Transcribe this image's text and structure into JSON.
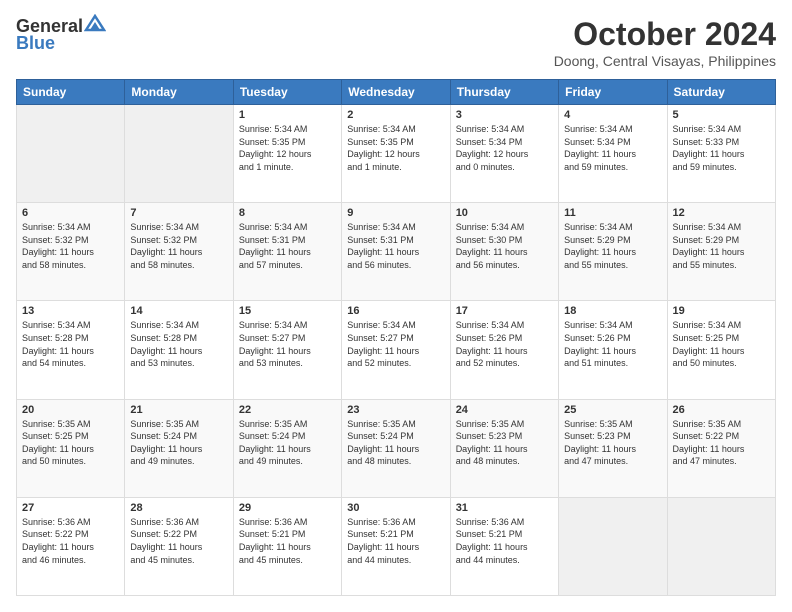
{
  "header": {
    "logo_line1": "General",
    "logo_line2": "Blue",
    "month_title": "October 2024",
    "subtitle": "Doong, Central Visayas, Philippines"
  },
  "days_of_week": [
    "Sunday",
    "Monday",
    "Tuesday",
    "Wednesday",
    "Thursday",
    "Friday",
    "Saturday"
  ],
  "weeks": [
    [
      {
        "day": "",
        "info": ""
      },
      {
        "day": "",
        "info": ""
      },
      {
        "day": "1",
        "info": "Sunrise: 5:34 AM\nSunset: 5:35 PM\nDaylight: 12 hours\nand 1 minute."
      },
      {
        "day": "2",
        "info": "Sunrise: 5:34 AM\nSunset: 5:35 PM\nDaylight: 12 hours\nand 1 minute."
      },
      {
        "day": "3",
        "info": "Sunrise: 5:34 AM\nSunset: 5:34 PM\nDaylight: 12 hours\nand 0 minutes."
      },
      {
        "day": "4",
        "info": "Sunrise: 5:34 AM\nSunset: 5:34 PM\nDaylight: 11 hours\nand 59 minutes."
      },
      {
        "day": "5",
        "info": "Sunrise: 5:34 AM\nSunset: 5:33 PM\nDaylight: 11 hours\nand 59 minutes."
      }
    ],
    [
      {
        "day": "6",
        "info": "Sunrise: 5:34 AM\nSunset: 5:32 PM\nDaylight: 11 hours\nand 58 minutes."
      },
      {
        "day": "7",
        "info": "Sunrise: 5:34 AM\nSunset: 5:32 PM\nDaylight: 11 hours\nand 58 minutes."
      },
      {
        "day": "8",
        "info": "Sunrise: 5:34 AM\nSunset: 5:31 PM\nDaylight: 11 hours\nand 57 minutes."
      },
      {
        "day": "9",
        "info": "Sunrise: 5:34 AM\nSunset: 5:31 PM\nDaylight: 11 hours\nand 56 minutes."
      },
      {
        "day": "10",
        "info": "Sunrise: 5:34 AM\nSunset: 5:30 PM\nDaylight: 11 hours\nand 56 minutes."
      },
      {
        "day": "11",
        "info": "Sunrise: 5:34 AM\nSunset: 5:29 PM\nDaylight: 11 hours\nand 55 minutes."
      },
      {
        "day": "12",
        "info": "Sunrise: 5:34 AM\nSunset: 5:29 PM\nDaylight: 11 hours\nand 55 minutes."
      }
    ],
    [
      {
        "day": "13",
        "info": "Sunrise: 5:34 AM\nSunset: 5:28 PM\nDaylight: 11 hours\nand 54 minutes."
      },
      {
        "day": "14",
        "info": "Sunrise: 5:34 AM\nSunset: 5:28 PM\nDaylight: 11 hours\nand 53 minutes."
      },
      {
        "day": "15",
        "info": "Sunrise: 5:34 AM\nSunset: 5:27 PM\nDaylight: 11 hours\nand 53 minutes."
      },
      {
        "day": "16",
        "info": "Sunrise: 5:34 AM\nSunset: 5:27 PM\nDaylight: 11 hours\nand 52 minutes."
      },
      {
        "day": "17",
        "info": "Sunrise: 5:34 AM\nSunset: 5:26 PM\nDaylight: 11 hours\nand 52 minutes."
      },
      {
        "day": "18",
        "info": "Sunrise: 5:34 AM\nSunset: 5:26 PM\nDaylight: 11 hours\nand 51 minutes."
      },
      {
        "day": "19",
        "info": "Sunrise: 5:34 AM\nSunset: 5:25 PM\nDaylight: 11 hours\nand 50 minutes."
      }
    ],
    [
      {
        "day": "20",
        "info": "Sunrise: 5:35 AM\nSunset: 5:25 PM\nDaylight: 11 hours\nand 50 minutes."
      },
      {
        "day": "21",
        "info": "Sunrise: 5:35 AM\nSunset: 5:24 PM\nDaylight: 11 hours\nand 49 minutes."
      },
      {
        "day": "22",
        "info": "Sunrise: 5:35 AM\nSunset: 5:24 PM\nDaylight: 11 hours\nand 49 minutes."
      },
      {
        "day": "23",
        "info": "Sunrise: 5:35 AM\nSunset: 5:24 PM\nDaylight: 11 hours\nand 48 minutes."
      },
      {
        "day": "24",
        "info": "Sunrise: 5:35 AM\nSunset: 5:23 PM\nDaylight: 11 hours\nand 48 minutes."
      },
      {
        "day": "25",
        "info": "Sunrise: 5:35 AM\nSunset: 5:23 PM\nDaylight: 11 hours\nand 47 minutes."
      },
      {
        "day": "26",
        "info": "Sunrise: 5:35 AM\nSunset: 5:22 PM\nDaylight: 11 hours\nand 47 minutes."
      }
    ],
    [
      {
        "day": "27",
        "info": "Sunrise: 5:36 AM\nSunset: 5:22 PM\nDaylight: 11 hours\nand 46 minutes."
      },
      {
        "day": "28",
        "info": "Sunrise: 5:36 AM\nSunset: 5:22 PM\nDaylight: 11 hours\nand 45 minutes."
      },
      {
        "day": "29",
        "info": "Sunrise: 5:36 AM\nSunset: 5:21 PM\nDaylight: 11 hours\nand 45 minutes."
      },
      {
        "day": "30",
        "info": "Sunrise: 5:36 AM\nSunset: 5:21 PM\nDaylight: 11 hours\nand 44 minutes."
      },
      {
        "day": "31",
        "info": "Sunrise: 5:36 AM\nSunset: 5:21 PM\nDaylight: 11 hours\nand 44 minutes."
      },
      {
        "day": "",
        "info": ""
      },
      {
        "day": "",
        "info": ""
      }
    ]
  ]
}
